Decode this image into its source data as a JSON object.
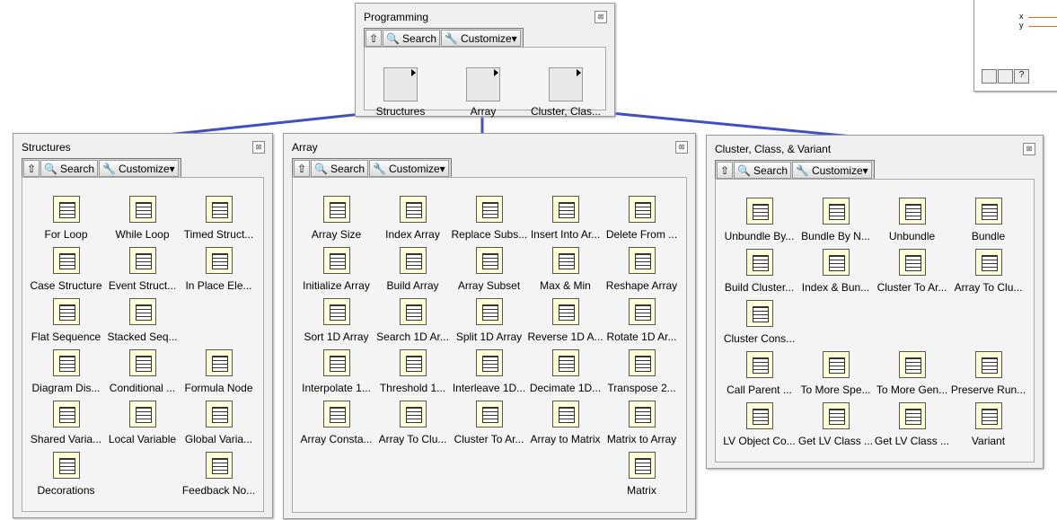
{
  "toolbar": {
    "search": "Search",
    "customize": "Customize▾"
  },
  "programming": {
    "title": "Programming",
    "items": [
      "Structures",
      "Array",
      "Cluster, Clas..."
    ]
  },
  "structures": {
    "title": "Structures",
    "items": [
      "For Loop",
      "While Loop",
      "Timed Struct...",
      "Case Structure",
      "Event Struct...",
      "In Place Ele...",
      "Flat Sequence",
      "Stacked Seq...",
      "",
      "Diagram Dis...",
      "Conditional ...",
      "Formula Node",
      "Shared Varia...",
      "Local Variable",
      "Global Varia...",
      "Decorations",
      "",
      "Feedback No..."
    ]
  },
  "array": {
    "title": "Array",
    "items": [
      "Array Size",
      "Index Array",
      "Replace Subs...",
      "Insert Into Ar...",
      "Delete From ...",
      "Initialize Array",
      "Build Array",
      "Array Subset",
      "Max & Min",
      "Reshape Array",
      "Sort 1D Array",
      "Search 1D Ar...",
      "Split 1D Array",
      "Reverse 1D A...",
      "Rotate 1D Ar...",
      "Interpolate 1...",
      "Threshold 1...",
      "Interleave 1D...",
      "Decimate 1D...",
      "Transpose 2...",
      "Array Consta...",
      "Array To Clu...",
      "Cluster To Ar...",
      "Array to Matrix",
      "Matrix to Array",
      "",
      "",
      "",
      "",
      "Matrix"
    ]
  },
  "cluster": {
    "title": "Cluster, Class, & Variant",
    "items": [
      "Unbundle By...",
      "Bundle By N...",
      "Unbundle",
      "Bundle",
      "Build Cluster...",
      "Index & Bun...",
      "Cluster To Ar...",
      "Array To Clu...",
      "Cluster Cons...",
      "",
      "",
      "",
      "Call Parent ...",
      "To More Spe...",
      "To More Gen...",
      "Preserve Run...",
      "LV Object Co...",
      "Get LV Class ...",
      "Get LV Class ...",
      "Variant"
    ]
  },
  "corner": {
    "labels": [
      "x",
      "y"
    ]
  },
  "colors": {
    "connector": "#4050c0",
    "plot": "#e07020"
  }
}
